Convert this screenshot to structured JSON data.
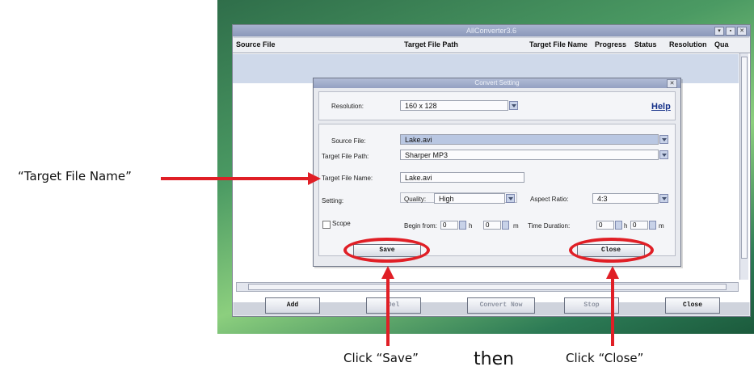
{
  "app": {
    "title": "AllConverter3.6"
  },
  "window_controls": [
    "▾",
    "▪",
    "✕"
  ],
  "table": {
    "columns": [
      "Source File",
      "Target File Path",
      "Target File Name",
      "Progress",
      "Status",
      "Resolution",
      "Qua"
    ]
  },
  "toolbar": {
    "add": "Add",
    "del": "Del",
    "convert": "Convert Now",
    "stop": "Stop",
    "close": "Close"
  },
  "dialog": {
    "title": "Convert Setting",
    "close_glyph": "✕",
    "resolution_label": "Resolution:",
    "resolution_value": "160 x 128",
    "help": "Help",
    "source_label": "Source File:",
    "source_value": "Lake.avi",
    "target_path_label": "Target File Path:",
    "target_path_value": "Sharper MP3",
    "target_name_label": "Target File Name:",
    "target_name_value": "Lake.avi",
    "setting_label": "Setting:",
    "quality_label": "Quality:",
    "quality_value": "High",
    "aspect_label": "Aspect Ratio:",
    "aspect_value": "4:3",
    "scope_label": "Scope",
    "begin_label": "Begin from:",
    "begin_h_value": "0",
    "begin_h_unit": "h",
    "begin_m_value": "0",
    "begin_m_unit": "m",
    "duration_label": "Time Duration:",
    "dur_h_value": "0",
    "dur_h_unit": "h",
    "dur_m_value": "0",
    "dur_m_unit": "m",
    "save": "Save",
    "close": "Close"
  },
  "annotations": {
    "target_callout": "“Target File Name”",
    "click_save": "Click “Save”",
    "then": "then",
    "click_close": "Click “Close”"
  },
  "colors": {
    "annotation": "#e01f26",
    "help_link": "#16328a",
    "selection": "#cfd9ea"
  }
}
